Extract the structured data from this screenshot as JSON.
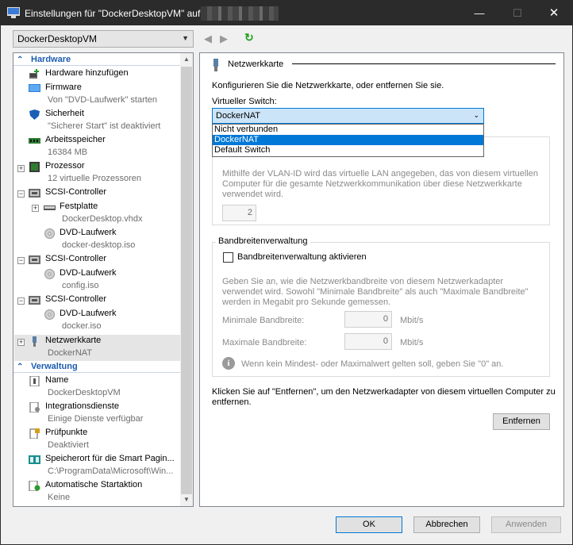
{
  "window": {
    "title": "Einstellungen für \"DockerDesktopVM\" auf",
    "minimize": "—",
    "maximize": "☐",
    "close": "✕"
  },
  "vm_select": {
    "value": "DockerDesktopVM"
  },
  "toolbar": {
    "back": "◀",
    "forward": "▶",
    "refresh": "↻"
  },
  "sidebar": {
    "hardware_header": "Hardware",
    "management_header": "Verwaltung",
    "items": [
      {
        "label": "Hardware hinzufügen",
        "sub": ""
      },
      {
        "label": "Firmware",
        "sub": "Von \"DVD-Laufwerk\" starten"
      },
      {
        "label": "Sicherheit",
        "sub": "\"Sicherer Start\" ist deaktiviert"
      },
      {
        "label": "Arbeitsspeicher",
        "sub": "16384 MB"
      },
      {
        "label": "Prozessor",
        "sub": "12 virtuelle Prozessoren"
      },
      {
        "label": "SCSI-Controller",
        "sub": ""
      },
      {
        "label": "Festplatte",
        "sub": "DockerDesktop.vhdx"
      },
      {
        "label": "DVD-Laufwerk",
        "sub": "docker-desktop.iso"
      },
      {
        "label": "SCSI-Controller",
        "sub": ""
      },
      {
        "label": "DVD-Laufwerk",
        "sub": "config.iso"
      },
      {
        "label": "SCSI-Controller",
        "sub": ""
      },
      {
        "label": "DVD-Laufwerk",
        "sub": "docker.iso"
      },
      {
        "label": "Netzwerkkarte",
        "sub": "DockerNAT"
      }
    ],
    "management": [
      {
        "label": "Name",
        "sub": "DockerDesktopVM"
      },
      {
        "label": "Integrationsdienste",
        "sub": "Einige Dienste verfügbar"
      },
      {
        "label": "Prüfpunkte",
        "sub": "Deaktiviert"
      },
      {
        "label": "Speicherort für die Smart Pagin...",
        "sub": "C:\\ProgramData\\Microsoft\\Win..."
      },
      {
        "label": "Automatische Startaktion",
        "sub": "Keine"
      }
    ]
  },
  "main": {
    "group_title": "Netzwerkkarte",
    "intro": "Konfigurieren Sie die Netzwerkkarte, oder entfernen Sie sie.",
    "switch_label": "Virtueller Switch:",
    "switch_value": "DockerNAT",
    "switch_options": [
      "Nicht verbunden",
      "DockerNAT",
      "Default Switch"
    ],
    "vlan_text_1": "Mithilfe der VLAN-ID wird das virtuelle LAN angegeben, das von diesem virtuellen",
    "vlan_text_2": "Computer für die gesamte Netzwerkkommunikation über diese Netzwerkkarte",
    "vlan_text_3": "verwendet wird.",
    "vlan_value": "2",
    "bandwidth_title": "Bandbreitenverwaltung",
    "bandwidth_checkbox": "Bandbreitenverwaltung aktivieren",
    "bandwidth_text_1": "Geben Sie an, wie die Netzwerkbandbreite von diesem Netzwerkadapter",
    "bandwidth_text_2": "verwendet wird. Sowohl \"Minimale Bandbreite\" als auch \"Maximale Bandbreite\"",
    "bandwidth_text_3": "werden in Megabit pro Sekunde gemessen.",
    "min_label": "Minimale Bandbreite:",
    "min_value": "0",
    "max_label": "Maximale Bandbreite:",
    "max_value": "0",
    "unit": "Mbit/s",
    "info_text": "Wenn kein Mindest- oder Maximalwert gelten soll, geben Sie \"0\" an.",
    "remove_text_1": "Klicken Sie auf \"Entfernen\", um den Netzwerkadapter von diesem virtuellen Computer zu",
    "remove_text_2": "entfernen.",
    "remove_button": "Entfernen"
  },
  "footer": {
    "ok": "OK",
    "cancel": "Abbrechen",
    "apply": "Anwenden"
  }
}
